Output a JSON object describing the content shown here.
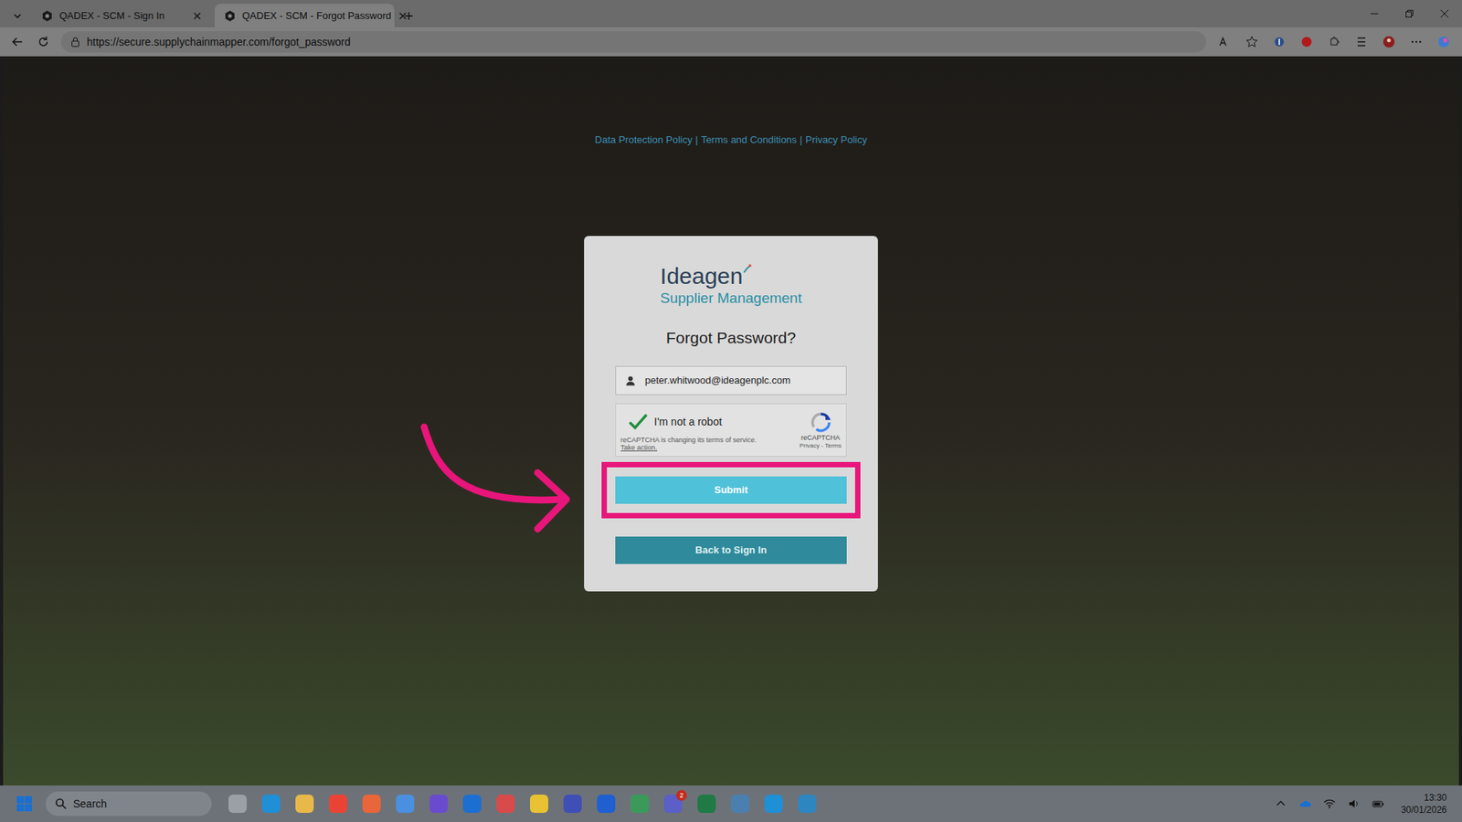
{
  "browser": {
    "tabs": [
      {
        "label": "QADEX - SCM - Sign In",
        "selected": false
      },
      {
        "label": "QADEX - SCM - Forgot Password",
        "selected": true
      }
    ],
    "url": "https://secure.supplychainmapper.com/forgot_password"
  },
  "page": {
    "links": [
      "Data Protection Policy",
      "Terms and Conditions",
      "Privacy Policy"
    ],
    "separator": "|",
    "logo": {
      "name": "Ideagen",
      "subtitle": "Supplier Management"
    },
    "heading": "Forgot Password?",
    "email": {
      "value": "peter.whitwood@ideagenplc.com"
    },
    "captcha": {
      "label": "I'm not a robot",
      "checked": true,
      "notice": "reCAPTCHA is changing its terms of service.",
      "action": "Take action.",
      "brand": "reCAPTCHA",
      "links": "Privacy - Terms"
    },
    "buttons": [
      {
        "label": "Submit",
        "highlighted": true
      },
      {
        "label": "Back to Sign In",
        "highlighted": false
      }
    ]
  },
  "taskbar": {
    "search": "Search",
    "apps": [
      {
        "color": "#9aa0a6"
      },
      {
        "color": "#1f8fd6"
      },
      {
        "color": "#e8b94a"
      },
      {
        "color": "#ea4335"
      },
      {
        "color": "#e8663a"
      },
      {
        "color": "#4a8fe0"
      },
      {
        "color": "#6a4bd0"
      },
      {
        "color": "#1c6fd1"
      },
      {
        "color": "#d94a4a"
      },
      {
        "color": "#e8c232"
      },
      {
        "color": "#3f4fb5"
      },
      {
        "color": "#1f5fd0"
      },
      {
        "color": "#3b9a5a"
      },
      {
        "color": "#5b5fc7",
        "badge": "2"
      },
      {
        "color": "#1f7a45"
      },
      {
        "color": "#4a7fb0"
      },
      {
        "color": "#1f8fd6"
      },
      {
        "color": "#2e86c1"
      }
    ],
    "time": "13:30",
    "date": "30/01/2026"
  }
}
